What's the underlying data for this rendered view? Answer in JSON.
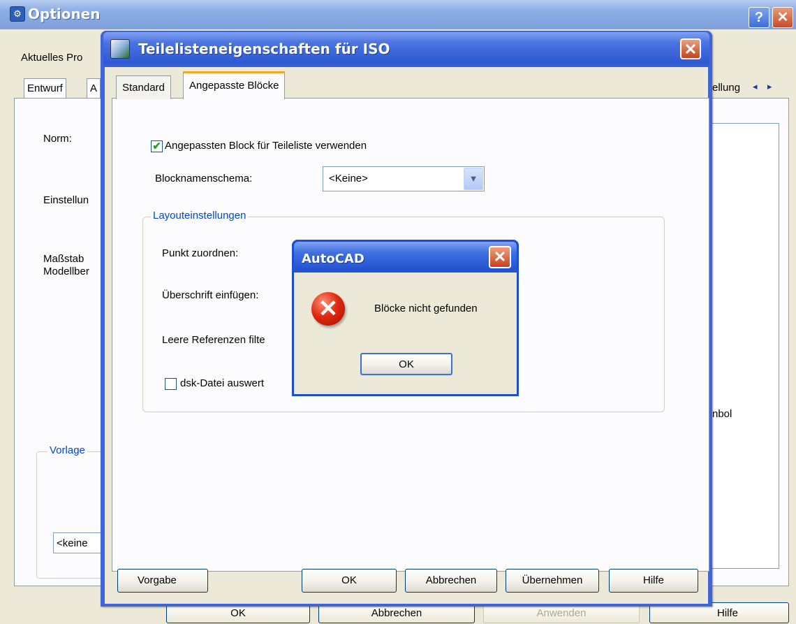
{
  "options_window": {
    "title": "Optionen",
    "help_glyph": "?",
    "close_glyph": "✕",
    "profile_label": "Aktuelles Pro",
    "tabs": [
      "Entwurf",
      "A"
    ],
    "tab_right_partial": "ellung",
    "tab_scroll_left": "◂",
    "tab_scroll_right": "▸",
    "labels": {
      "norm": "Norm:",
      "einstellung": "Einstellun",
      "massstab_line1": "Maßstab",
      "massstab_line2": "Modellber",
      "symbol_partial": "nbol"
    },
    "group_vorlage": "Vorlage",
    "field_keine": "<keine",
    "bottom_buttons": {
      "ok": "OK",
      "abbrechen": "Abbrechen",
      "anwenden": "Anwenden",
      "hilfe": "Hilfe"
    }
  },
  "dialog": {
    "title": "Teilelisteneigenschaften für ISO",
    "close_glyph": "✕",
    "tabs": [
      {
        "label": "Standard",
        "active": false
      },
      {
        "label": "Angepasste Blöcke",
        "active": true
      }
    ],
    "use_custom_block": {
      "label": "Angepassten Block für Teileliste verwenden",
      "checked": true
    },
    "block_name_scheme": {
      "label": "Blocknamenschema:",
      "value": "<Keine>"
    },
    "layout_group": {
      "title": "Layouteinstellungen",
      "punkt_zuordnen": "Punkt zuordnen:",
      "ueberschrift": "Überschrift einfügen:",
      "leere_referenzen": "Leere Referenzen filte",
      "dsk_datei": {
        "label": "dsk-Datei auswert",
        "checked": false
      }
    },
    "buttons": {
      "vorgabe": "Vorgabe",
      "ok": "OK",
      "abbrechen": "Abbrechen",
      "uebernehmen": "Übernehmen",
      "hilfe": "Hilfe"
    }
  },
  "message_box": {
    "title": "AutoCAD",
    "close_glyph": "✕",
    "icon": "error-icon",
    "icon_glyph": "✕",
    "message": "Blöcke nicht gefunden",
    "ok": "OK"
  }
}
